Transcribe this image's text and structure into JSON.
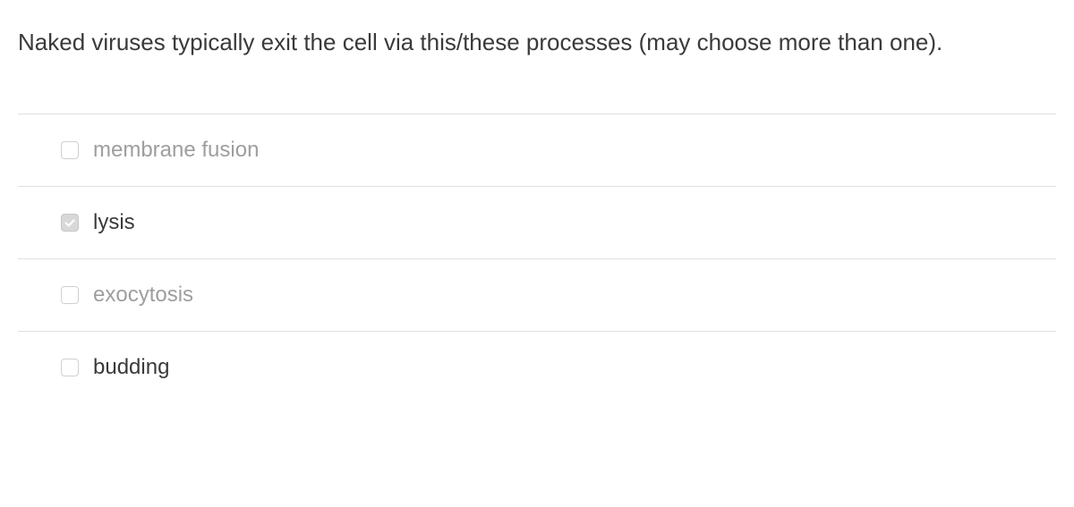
{
  "question": {
    "text": "Naked viruses typically exit the cell via this/these processes (may choose more than one)."
  },
  "options": [
    {
      "label": "membrane fusion",
      "checked": false,
      "faded": true
    },
    {
      "label": "lysis",
      "checked": true,
      "faded": false
    },
    {
      "label": "exocytosis",
      "checked": false,
      "faded": true
    },
    {
      "label": "budding",
      "checked": false,
      "faded": false
    }
  ]
}
